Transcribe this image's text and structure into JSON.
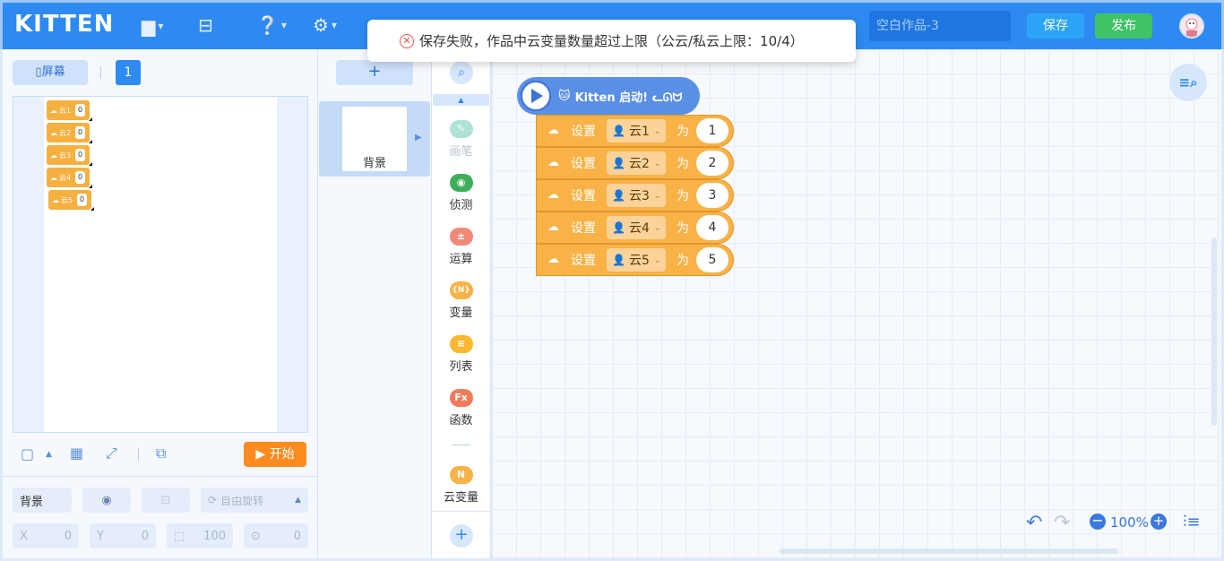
{
  "app": {
    "logo": "KITTEN",
    "work_name": "空白作品-3",
    "save_label": "保存",
    "publish_label": "发布"
  },
  "toast": {
    "message": "保存失败，作品中云变量数量超过上限（公云/私云上限：10/4）"
  },
  "stage": {
    "screen_label": "屏幕",
    "page_number": "1",
    "start_label": "开始",
    "cloud_vars": [
      {
        "name": "云1",
        "value": "0"
      },
      {
        "name": "云2",
        "value": "0"
      },
      {
        "name": "云3",
        "value": "0"
      },
      {
        "name": "云4",
        "value": "0"
      },
      {
        "name": "云5",
        "value": "0"
      }
    ]
  },
  "props": {
    "sprite_name": "背景",
    "rotate_label": "自由旋转",
    "x_label": "X",
    "x_value": "0",
    "y_label": "Y",
    "y_value": "0",
    "size_value": "100",
    "dir_value": "0"
  },
  "sprites": {
    "add_label": "+",
    "background_label": "背景"
  },
  "categories": [
    {
      "label": "画笔",
      "color": "#8fdac6",
      "glyph": "✎"
    },
    {
      "label": "侦测",
      "color": "#3fae5a",
      "glyph": "◉"
    },
    {
      "label": "运算",
      "color": "#f08a78",
      "glyph": "±"
    },
    {
      "label": "变量",
      "color": "#f9b246",
      "glyph": "{N}"
    },
    {
      "label": "列表",
      "color": "#f9b830",
      "glyph": "≡"
    },
    {
      "label": "函数",
      "color": "#f07a5a",
      "glyph": "Fx"
    },
    {
      "label": "云变量",
      "color": "#f9b246",
      "glyph": "N"
    }
  ],
  "script": {
    "hat_label": "Kitten 启动! ᓚᘏᗢ",
    "set_label": "设置",
    "to_label": "为",
    "blocks": [
      {
        "var": "云1",
        "value": "1"
      },
      {
        "var": "云2",
        "value": "2"
      },
      {
        "var": "云3",
        "value": "3"
      },
      {
        "var": "云4",
        "value": "4"
      },
      {
        "var": "云5",
        "value": "5"
      }
    ]
  },
  "workspace": {
    "zoom": "100%"
  }
}
